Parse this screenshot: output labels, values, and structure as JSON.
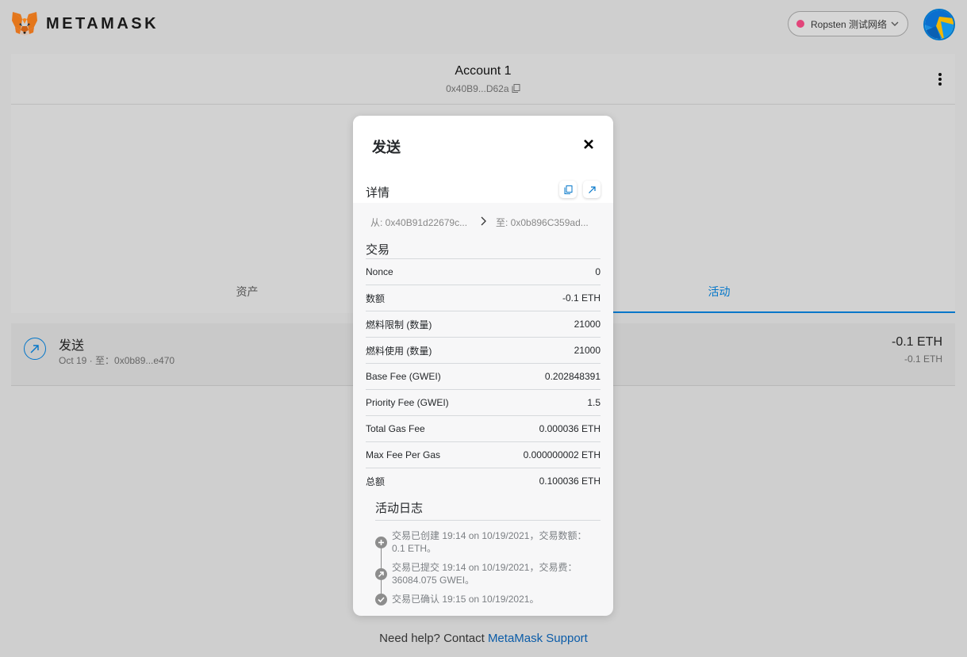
{
  "header": {
    "brand": "METAMASK",
    "network": {
      "label": "Ropsten 测试网络",
      "dot_color": "#e2457a"
    }
  },
  "account": {
    "name": "Account 1",
    "address": "0x40B9...D62a"
  },
  "tabs": [
    {
      "label": "资产"
    },
    {
      "label": "活动"
    }
  ],
  "transaction": {
    "title": "发送",
    "subtitle": "Oct 19 · 至：0x0b89...e470",
    "amount": "-0.1 ETH",
    "amount_secondary": "-0.1 ETH"
  },
  "help": {
    "prefix": "Need help? Contact ",
    "link": "MetaMask Support"
  },
  "modal": {
    "title": "发送",
    "details_label": "详情",
    "from": "从: 0x40B91d22679c...",
    "to": "至: 0x0b896C359ad...",
    "tx_section": "交易",
    "rows": [
      {
        "label": "Nonce",
        "value": "0"
      },
      {
        "label": "数额",
        "value": "-0.1 ETH"
      },
      {
        "label": "燃料限制 (数量)",
        "value": "21000"
      },
      {
        "label": "燃料使用 (数量)",
        "value": "21000"
      },
      {
        "label": "Base Fee (GWEI)",
        "value": "0.202848391"
      },
      {
        "label": "Priority Fee (GWEI)",
        "value": "1.5"
      },
      {
        "label": "Total Gas Fee",
        "value": "0.000036 ETH"
      },
      {
        "label": "Max Fee Per Gas",
        "value": "0.000000002 ETH"
      },
      {
        "label": "总额",
        "value": "0.100036 ETH"
      }
    ],
    "activity_title": "活动日志",
    "activity": [
      {
        "text": "交易已创建 19:14 on 10/19/2021，交易数额：0.1 ETH。",
        "icon": "plus-icon"
      },
      {
        "text": "交易已提交 19:14 on 10/19/2021，交易费：36084.075 GWEI。",
        "icon": "arrow-up-right-icon"
      },
      {
        "text": "交易已确认 19:15 on 10/19/2021。",
        "icon": "check-icon"
      }
    ]
  },
  "colors": {
    "accent": "#0376c9",
    "overlay_bg": "#cfcfcf"
  }
}
